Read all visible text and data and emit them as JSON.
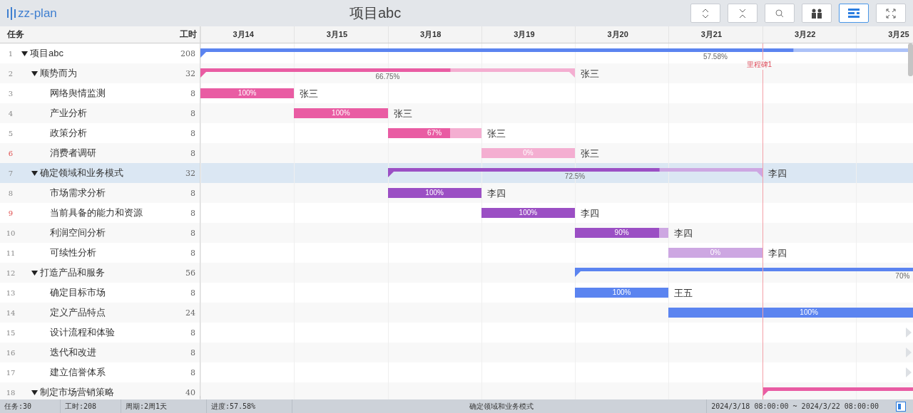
{
  "app": {
    "logo": "zz-plan",
    "title": "项目abc"
  },
  "toolbar": [
    {
      "kind": "expand",
      "selected": false
    },
    {
      "kind": "collapse",
      "selected": false
    },
    {
      "kind": "search",
      "selected": false
    },
    {
      "kind": "people",
      "selected": false
    },
    {
      "kind": "list",
      "selected": true
    },
    {
      "kind": "fullscreen",
      "selected": false
    }
  ],
  "columns": {
    "task": "任务",
    "hours": "工时"
  },
  "dates": [
    "3月14",
    "3月15",
    "3月18",
    "3月19",
    "3月20",
    "3月21",
    "3月22",
    "3月25"
  ],
  "milestone": {
    "label": "里程碑1"
  },
  "tasks": [
    {
      "no": "1",
      "name": "项目abc",
      "hours": "208",
      "expanded": true,
      "flagged": false,
      "selected": false,
      "color": "#5b84f0",
      "bar": {
        "kind": "summary",
        "level": 0.5758,
        "progress": "57.58%"
      },
      "children": [
        {
          "no": "2",
          "name": "顺势而为",
          "hours": "32",
          "expanded": true,
          "flagged": false,
          "selected": false,
          "color": "#e95ca3",
          "bar": {
            "kind": "summary",
            "level": 0.6675,
            "progress": "66.75%",
            "assignee": "张三"
          },
          "children": [
            {
              "no": "3",
              "name": "网络舆情监测",
              "hours": "8",
              "flagged": false,
              "selected": false,
              "bar": {
                "kind": "task",
                "level": 1,
                "progress": "100%",
                "assignee": "张三"
              }
            },
            {
              "no": "4",
              "name": "产业分析",
              "hours": "8",
              "flagged": false,
              "selected": false,
              "bar": {
                "kind": "task",
                "level": 1,
                "progress": "100%",
                "assignee": "张三"
              }
            },
            {
              "no": "5",
              "name": "政策分析",
              "hours": "8",
              "flagged": false,
              "selected": false,
              "bar": {
                "kind": "task",
                "level": 0.67,
                "progress": "67%",
                "assignee": "张三"
              }
            },
            {
              "no": "6",
              "name": "消费者调研",
              "hours": "8",
              "flagged": true,
              "selected": false,
              "bar": {
                "kind": "task",
                "level": 0,
                "progress": "0%",
                "assignee": "张三"
              }
            }
          ]
        },
        {
          "no": "7",
          "name": "确定领域和业务模式",
          "hours": "32",
          "expanded": true,
          "flagged": false,
          "selected": true,
          "color": "#9b4fc4",
          "bar": {
            "kind": "summary",
            "level": 0.725,
            "progress": "72.5%",
            "assignee": "李四"
          },
          "children": [
            {
              "no": "8",
              "name": "市场需求分析",
              "hours": "8",
              "flagged": false,
              "selected": false,
              "bar": {
                "kind": "task",
                "level": 1,
                "progress": "100%",
                "assignee": "李四"
              }
            },
            {
              "no": "9",
              "name": "当前具备的能力和资源",
              "hours": "8",
              "flagged": true,
              "selected": false,
              "bar": {
                "kind": "task",
                "level": 1,
                "progress": "100%",
                "assignee": "李四"
              }
            },
            {
              "no": "10",
              "name": "利润空间分析",
              "hours": "8",
              "flagged": false,
              "selected": false,
              "bar": {
                "kind": "task",
                "level": 0.9,
                "progress": "90%",
                "assignee": "李四"
              }
            },
            {
              "no": "11",
              "name": "可续性分析",
              "hours": "8",
              "flagged": false,
              "selected": false,
              "bar": {
                "kind": "task",
                "level": 0,
                "progress": "0%",
                "assignee": "李四"
              }
            }
          ]
        },
        {
          "no": "12",
          "name": "打造产品和服务",
          "hours": "56",
          "expanded": true,
          "flagged": false,
          "selected": false,
          "color": "#5b84f0",
          "bar": {
            "kind": "summary",
            "level": 1,
            "progress": "70%"
          },
          "children": [
            {
              "no": "13",
              "name": "确定目标市场",
              "hours": "8",
              "flagged": false,
              "selected": false,
              "bar": {
                "kind": "task",
                "level": 1,
                "progress": "100%",
                "assignee": "王五"
              }
            },
            {
              "no": "14",
              "name": "定义产品特点",
              "hours": "24",
              "flagged": false,
              "selected": false,
              "bar": {
                "kind": "task",
                "level": 1,
                "progress": "100%"
              }
            },
            {
              "no": "15",
              "name": "设计流程和体验",
              "hours": "8",
              "flagged": false,
              "selected": false,
              "bar": {
                "kind": "offscreen"
              }
            },
            {
              "no": "16",
              "name": "迭代和改进",
              "hours": "8",
              "flagged": false,
              "selected": false,
              "bar": {
                "kind": "offscreen"
              }
            },
            {
              "no": "17",
              "name": "建立信誉体系",
              "hours": "8",
              "flagged": false,
              "selected": false,
              "bar": {
                "kind": "offscreen"
              }
            }
          ]
        },
        {
          "no": "18",
          "name": "制定市场营销策略",
          "hours": "40",
          "expanded": true,
          "flagged": false,
          "selected": false,
          "color": "#e95ca3",
          "bar": {
            "kind": "summary",
            "level": 1
          }
        }
      ]
    }
  ],
  "status_bar": {
    "tasks": "任务:30",
    "hours": "工时:208",
    "period": "周期:2周1天",
    "progress": "进度:57.58%",
    "selected_task": "确定领域和业务模式",
    "range": "2024/3/18 08:00:00 ~ 2024/3/22 08:00:00"
  }
}
